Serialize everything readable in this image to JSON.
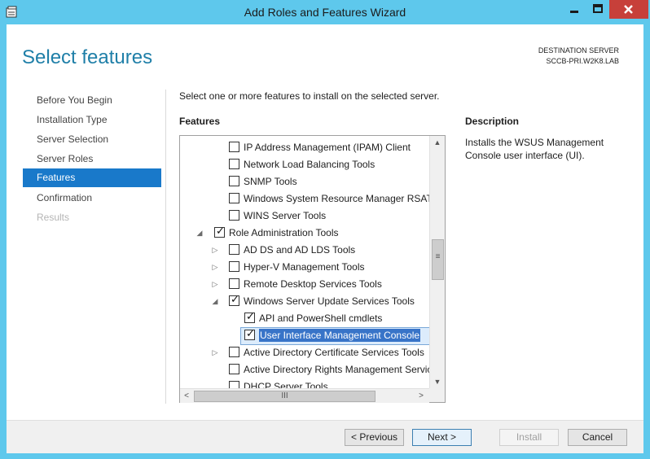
{
  "window": {
    "title": "Add Roles and Features Wizard",
    "controls": {
      "minimize": "minimize-icon",
      "maximize": "maximize-icon",
      "close": "close-icon"
    }
  },
  "page": {
    "heading": "Select features",
    "destination_label": "DESTINATION SERVER",
    "destination_value": "SCCB-PRI.W2K8.LAB",
    "instruction": "Select one or more features to install on the selected server.",
    "features_label": "Features",
    "description_label": "Description",
    "description_text": "Installs the WSUS Management Console user interface (UI)."
  },
  "nav": [
    {
      "label": "Before You Begin",
      "state": "normal"
    },
    {
      "label": "Installation Type",
      "state": "normal"
    },
    {
      "label": "Server Selection",
      "state": "normal"
    },
    {
      "label": "Server Roles",
      "state": "normal"
    },
    {
      "label": "Features",
      "state": "selected"
    },
    {
      "label": "Confirmation",
      "state": "normal"
    },
    {
      "label": "Results",
      "state": "disabled"
    }
  ],
  "tree": [
    {
      "label": "IP Address Management (IPAM) Client",
      "level": 2,
      "expander": "",
      "checked": false
    },
    {
      "label": "Network Load Balancing Tools",
      "level": 2,
      "expander": "",
      "checked": false
    },
    {
      "label": "SNMP Tools",
      "level": 2,
      "expander": "",
      "checked": false
    },
    {
      "label": "Windows System Resource Manager RSAT",
      "level": 2,
      "expander": "",
      "checked": false
    },
    {
      "label": "WINS Server Tools",
      "level": 2,
      "expander": "",
      "checked": false
    },
    {
      "label": "Role Administration Tools",
      "level": 1,
      "expander": "expanded",
      "checked": true
    },
    {
      "label": "AD DS and AD LDS Tools",
      "level": 2,
      "expander": "collapsed",
      "checked": false
    },
    {
      "label": "Hyper-V Management Tools",
      "level": 2,
      "expander": "collapsed",
      "checked": false
    },
    {
      "label": "Remote Desktop Services Tools",
      "level": 2,
      "expander": "collapsed",
      "checked": false
    },
    {
      "label": "Windows Server Update Services Tools",
      "level": 2,
      "expander": "expanded",
      "checked": true
    },
    {
      "label": "API and PowerShell cmdlets",
      "level": 3,
      "expander": "",
      "checked": true
    },
    {
      "label": "User Interface Management Console",
      "level": 3,
      "expander": "",
      "checked": true,
      "selected": true
    },
    {
      "label": "Active Directory Certificate Services Tools",
      "level": 2,
      "expander": "collapsed",
      "checked": false
    },
    {
      "label": "Active Directory Rights Management Servic",
      "level": 2,
      "expander": "",
      "checked": false
    },
    {
      "label": "DHCP Server Tools",
      "level": 2,
      "expander": "",
      "checked": false
    }
  ],
  "buttons": {
    "previous": "< Previous",
    "next": "Next >",
    "install": "Install",
    "cancel": "Cancel"
  },
  "colors": {
    "accent": "#1979ca",
    "titlebar": "#5ec8ec",
    "heading": "#1f7fa8",
    "close": "#c7403a"
  }
}
